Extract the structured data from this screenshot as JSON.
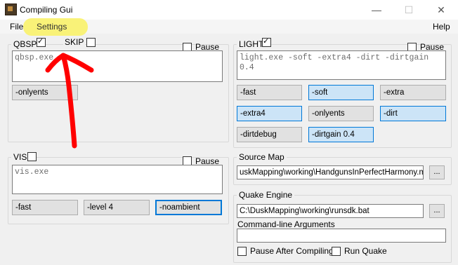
{
  "window": {
    "title": "Compiling Gui",
    "minimize": "—",
    "maximize": "☐",
    "close": "✕"
  },
  "menu": {
    "file": "File",
    "settings": "Settings",
    "help": "Help"
  },
  "qbsp": {
    "label": "QBSP",
    "checked": true,
    "skip_label": "SKIP",
    "skip_checked": false,
    "pause_label": "Pause",
    "pause_checked": false,
    "command": "qbsp.exe",
    "flags": [
      {
        "label": "-onlyents",
        "active": false
      }
    ]
  },
  "light": {
    "label": "LIGHT",
    "checked": true,
    "pause_label": "Pause",
    "pause_checked": false,
    "command": "light.exe -soft -extra4 -dirt -dirtgain 0.4",
    "flags": [
      {
        "label": "-fast",
        "active": false
      },
      {
        "label": "-soft",
        "active": true
      },
      {
        "label": "-extra",
        "active": false
      },
      {
        "label": "-extra4",
        "active": true
      },
      {
        "label": "-onlyents",
        "active": false
      },
      {
        "label": "-dirt",
        "active": true
      },
      {
        "label": "-dirtdebug",
        "active": false
      },
      {
        "label": "-dirtgain 0.4",
        "active": true
      }
    ]
  },
  "vis": {
    "label": "VIS",
    "checked": false,
    "pause_label": "Pause",
    "pause_checked": false,
    "command": "vis.exe",
    "flags": [
      {
        "label": "-fast",
        "active": false
      },
      {
        "label": "-level 4",
        "active": false
      },
      {
        "label": "-noambient",
        "active": false
      }
    ]
  },
  "source_map": {
    "label": "Source Map",
    "path": "uskMapping\\working\\HandgunsInPerfectHarmony.map",
    "browse": "..."
  },
  "quake_engine": {
    "label": "Quake Engine",
    "path": "C:\\DuskMapping\\working\\runsdk.bat",
    "browse": "...",
    "args_label": "Command-line Arguments",
    "args_value": "",
    "pause_after_label": "Pause After Compiling",
    "pause_after_checked": false,
    "run_quake_label": "Run Quake",
    "run_quake_checked": false
  },
  "colors": {
    "highlight": "#faf26a",
    "annotation_arrow": "#ff0000",
    "active_button": "#cce4f7",
    "accent": "#0078d7"
  }
}
